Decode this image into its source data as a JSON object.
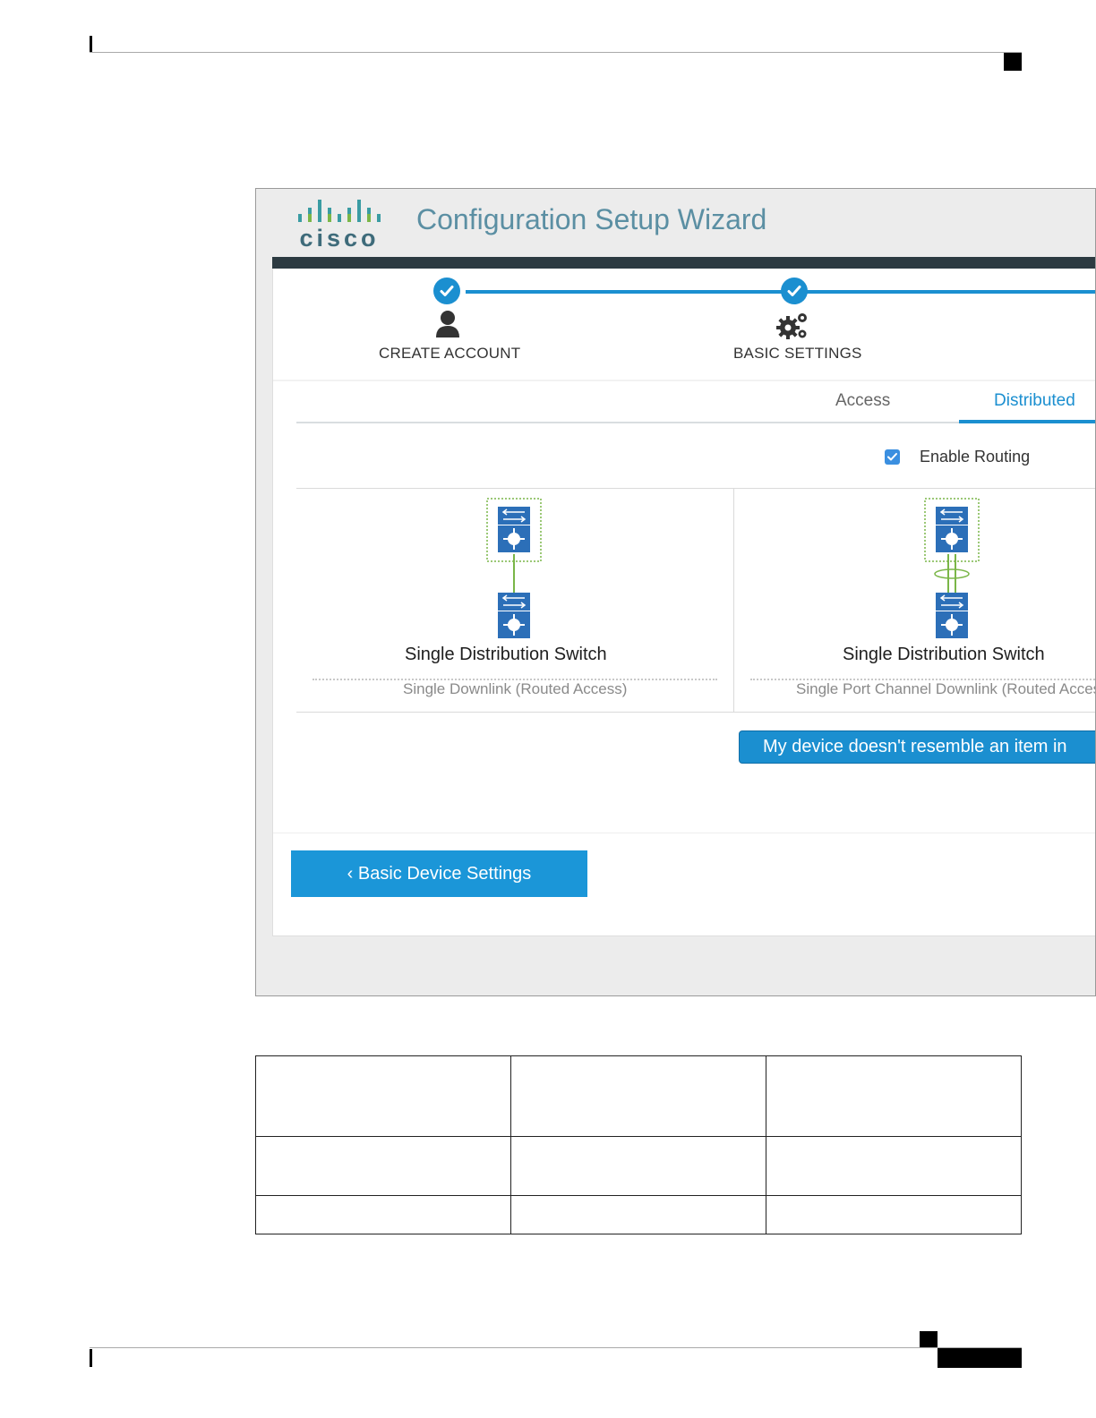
{
  "wizard": {
    "title": "Configuration Setup Wizard",
    "logo_text": "cisco",
    "colors": {
      "accent": "#1b8fd0",
      "header_bar": "#2c3a41",
      "logo_teal": "#3a9ca3",
      "logo_green": "#7ab648"
    },
    "steps": [
      {
        "label": "CREATE ACCOUNT",
        "icon": "user-icon",
        "status": "complete"
      },
      {
        "label": "BASIC SETTINGS",
        "icon": "gears-icon",
        "status": "complete"
      }
    ],
    "tabs": [
      {
        "label": "Access",
        "active": false
      },
      {
        "label": "Distributed",
        "active": true
      }
    ],
    "enable_routing": {
      "label": "Enable Routing",
      "checked": true
    },
    "options": [
      {
        "title": "Single Distribution Switch",
        "subtitle": "Single Downlink (Routed Access)",
        "icon": "switch-stack-icon"
      },
      {
        "title": "Single Distribution Switch",
        "subtitle": "Single Port Channel Downlink (Routed Access)",
        "icon": "switch-portchannel-icon"
      }
    ],
    "resemble_button": "My device doesn't resemble an item in",
    "back_button": "Basic Device Settings"
  },
  "table": {
    "rows": 3,
    "columns": 3
  }
}
